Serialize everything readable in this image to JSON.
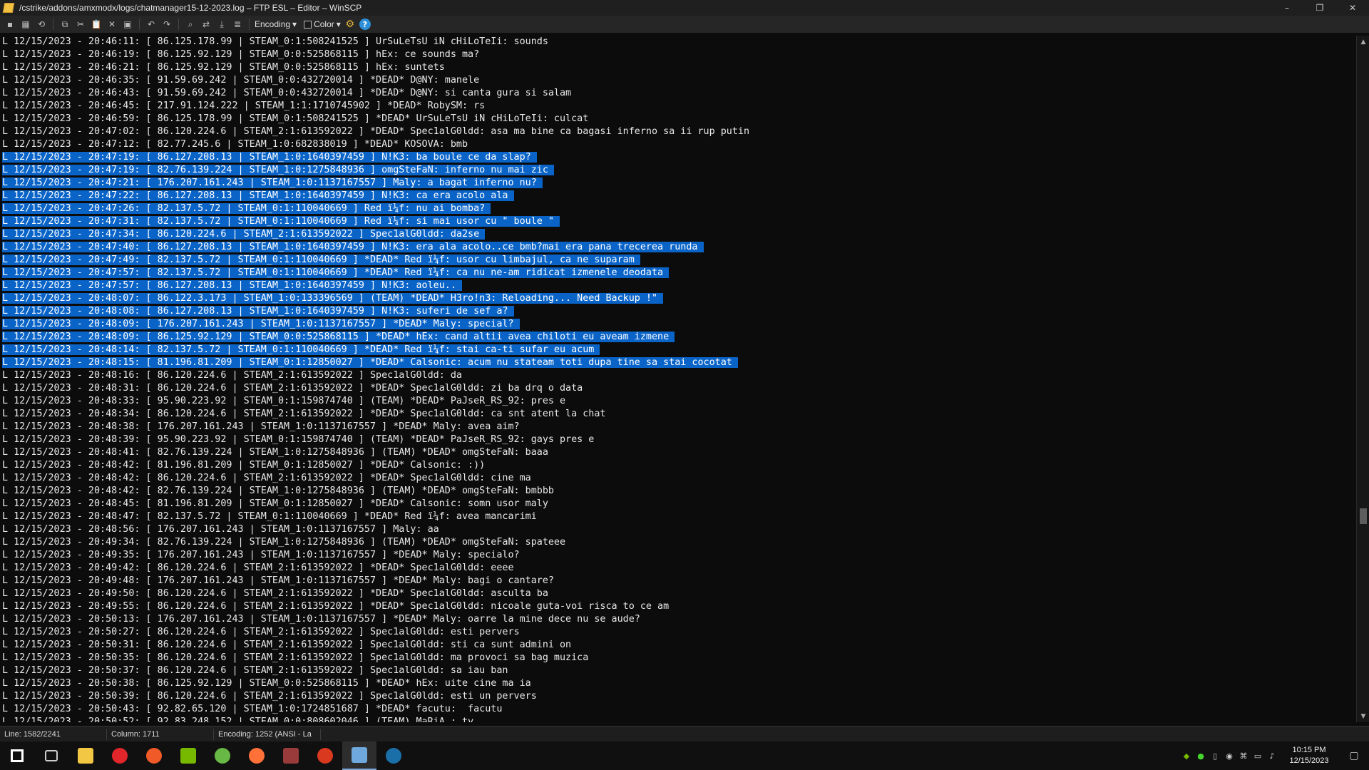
{
  "window": {
    "title": "/cstrike/addons/amxmodx/logs/chatmanager15-12-2023.log – FTP ESL – Editor – WinSCP",
    "minimize": "–",
    "restore": "❐",
    "close": "✕"
  },
  "toolbar": {
    "encoding_label": "Encoding",
    "color_label": "Color",
    "help_label": "?"
  },
  "editor": {
    "lines": [
      {
        "text": "L 12/15/2023 - 20:46:11: [ 86.125.178.99 | STEAM_0:1:508241525 ] UrSuLeTsU iN cHiLoTeIi: sounds",
        "selected": false
      },
      {
        "text": "L 12/15/2023 - 20:46:19: [ 86.125.92.129 | STEAM_0:0:525868115 ] hEx: ce sounds ma?",
        "selected": false
      },
      {
        "text": "L 12/15/2023 - 20:46:21: [ 86.125.92.129 | STEAM_0:0:525868115 ] hEx: suntets",
        "selected": false
      },
      {
        "text": "L 12/15/2023 - 20:46:35: [ 91.59.69.242 | STEAM_0:0:432720014 ] *DEAD* D@NY: manele",
        "selected": false
      },
      {
        "text": "L 12/15/2023 - 20:46:43: [ 91.59.69.242 | STEAM_0:0:432720014 ] *DEAD* D@NY: si canta gura si salam",
        "selected": false
      },
      {
        "text": "L 12/15/2023 - 20:46:45: [ 217.91.124.222 | STEAM_1:1:1710745902 ] *DEAD* RobySM: rs",
        "selected": false
      },
      {
        "text": "L 12/15/2023 - 20:46:59: [ 86.125.178.99 | STEAM_0:1:508241525 ] *DEAD* UrSuLeTsU iN cHiLoTeIi: culcat",
        "selected": false
      },
      {
        "text": "L 12/15/2023 - 20:47:02: [ 86.120.224.6 | STEAM_2:1:613592022 ] *DEAD* Spec1alG0ldd: asa ma bine ca bagasi inferno sa ii rup putin",
        "selected": false
      },
      {
        "text": "L 12/15/2023 - 20:47:12: [ 82.77.245.6 | STEAM_1:0:682838019 ] *DEAD* KOSOVA: bmb",
        "selected": false
      },
      {
        "text": "L 12/15/2023 - 20:47:19: [ 86.127.208.13 | STEAM_1:0:1640397459 ] N!K3: ba boule ce da slap? ",
        "selected": true
      },
      {
        "text": "L 12/15/2023 - 20:47:19: [ 82.76.139.224 | STEAM_1:0:1275848936 ] omgSteFaN: inferno nu mai zic ",
        "selected": true
      },
      {
        "text": "L 12/15/2023 - 20:47:21: [ 176.207.161.243 | STEAM_1:0:1137167557 ] Maly: a bagat inferno nu? ",
        "selected": true
      },
      {
        "text": "L 12/15/2023 - 20:47:22: [ 86.127.208.13 | STEAM_1:0:1640397459 ] N!K3: ca era acolo ala ",
        "selected": true
      },
      {
        "text": "L 12/15/2023 - 20:47:26: [ 82.137.5.72 | STEAM_0:1:110040669 ] Red ï¼f: nu ai bomba? ",
        "selected": true
      },
      {
        "text": "L 12/15/2023 - 20:47:31: [ 82.137.5.72 | STEAM_0:1:110040669 ] Red ï¼f: si mai usor cu \" boule \" ",
        "selected": true
      },
      {
        "text": "L 12/15/2023 - 20:47:34: [ 86.120.224.6 | STEAM_2:1:613592022 ] Spec1alG0ldd: da2se ",
        "selected": true
      },
      {
        "text": "L 12/15/2023 - 20:47:40: [ 86.127.208.13 | STEAM_1:0:1640397459 ] N!K3: era ala acolo..ce bmb?mai era pana trecerea runda ",
        "selected": true
      },
      {
        "text": "L 12/15/2023 - 20:47:49: [ 82.137.5.72 | STEAM_0:1:110040669 ] *DEAD* Red ï¼f: usor cu limbajul, ca ne suparam ",
        "selected": true
      },
      {
        "text": "L 12/15/2023 - 20:47:57: [ 82.137.5.72 | STEAM_0:1:110040669 ] *DEAD* Red ï¼f: ca nu ne-am ridicat izmenele deodata ",
        "selected": true
      },
      {
        "text": "L 12/15/2023 - 20:47:57: [ 86.127.208.13 | STEAM_1:0:1640397459 ] N!K3: aoleu.. ",
        "selected": true
      },
      {
        "text": "L 12/15/2023 - 20:48:07: [ 86.122.3.173 | STEAM_1:0:133396569 ] (TEAM) *DEAD* H3ro!n3: Reloading... Need Backup !\" ",
        "selected": true
      },
      {
        "text": "L 12/15/2023 - 20:48:08: [ 86.127.208.13 | STEAM_1:0:1640397459 ] N!K3: suferi de sef a? ",
        "selected": true
      },
      {
        "text": "L 12/15/2023 - 20:48:09: [ 176.207.161.243 | STEAM_1:0:1137167557 ] *DEAD* Maly: special? ",
        "selected": true
      },
      {
        "text": "L 12/15/2023 - 20:48:09: [ 86.125.92.129 | STEAM_0:0:525868115 ] *DEAD* hEx: cand altii avea chiloti eu aveam izmene ",
        "selected": true
      },
      {
        "text": "L 12/15/2023 - 20:48:14: [ 82.137.5.72 | STEAM_0:1:110040669 ] *DEAD* Red ï¼f: stai ca-ti sufar eu acum ",
        "selected": true
      },
      {
        "text": "L 12/15/2023 - 20:48:15: [ 81.196.81.209 | STEAM_0:1:12850027 ] *DEAD* Calsonic: acum nu stateam toti dupa tine sa stai cocotat ",
        "selected": true
      },
      {
        "text": "L 12/15/2023 - 20:48:16: [ 86.120.224.6 | STEAM_2:1:613592022 ] Spec1alG0ldd: da",
        "selected": false
      },
      {
        "text": "L 12/15/2023 - 20:48:31: [ 86.120.224.6 | STEAM_2:1:613592022 ] *DEAD* Spec1alG0ldd: zi ba drq o data",
        "selected": false
      },
      {
        "text": "L 12/15/2023 - 20:48:33: [ 95.90.223.92 | STEAM_0:1:159874740 ] (TEAM) *DEAD* PaJseR_RS_92: pres e",
        "selected": false
      },
      {
        "text": "L 12/15/2023 - 20:48:34: [ 86.120.224.6 | STEAM_2:1:613592022 ] *DEAD* Spec1alG0ldd: ca snt atent la chat",
        "selected": false
      },
      {
        "text": "L 12/15/2023 - 20:48:38: [ 176.207.161.243 | STEAM_1:0:1137167557 ] *DEAD* Maly: avea aim?",
        "selected": false
      },
      {
        "text": "L 12/15/2023 - 20:48:39: [ 95.90.223.92 | STEAM_0:1:159874740 ] (TEAM) *DEAD* PaJseR_RS_92: gays pres e",
        "selected": false
      },
      {
        "text": "L 12/15/2023 - 20:48:41: [ 82.76.139.224 | STEAM_1:0:1275848936 ] (TEAM) *DEAD* omgSteFaN: baaa",
        "selected": false
      },
      {
        "text": "L 12/15/2023 - 20:48:42: [ 81.196.81.209 | STEAM_0:1:12850027 ] *DEAD* Calsonic: :))",
        "selected": false
      },
      {
        "text": "L 12/15/2023 - 20:48:42: [ 86.120.224.6 | STEAM_2:1:613592022 ] *DEAD* Spec1alG0ldd: cine ma",
        "selected": false
      },
      {
        "text": "L 12/15/2023 - 20:48:42: [ 82.76.139.224 | STEAM_1:0:1275848936 ] (TEAM) *DEAD* omgSteFaN: bmbbb",
        "selected": false
      },
      {
        "text": "L 12/15/2023 - 20:48:45: [ 81.196.81.209 | STEAM_0:1:12850027 ] *DEAD* Calsonic: somn usor maly",
        "selected": false
      },
      {
        "text": "L 12/15/2023 - 20:48:47: [ 82.137.5.72 | STEAM_0:1:110040669 ] *DEAD* Red ï¼f: avea mancarimi",
        "selected": false
      },
      {
        "text": "L 12/15/2023 - 20:48:56: [ 176.207.161.243 | STEAM_1:0:1137167557 ] Maly: aa",
        "selected": false
      },
      {
        "text": "L 12/15/2023 - 20:49:34: [ 82.76.139.224 | STEAM_1:0:1275848936 ] (TEAM) *DEAD* omgSteFaN: spateee",
        "selected": false
      },
      {
        "text": "L 12/15/2023 - 20:49:35: [ 176.207.161.243 | STEAM_1:0:1137167557 ] *DEAD* Maly: specialo?",
        "selected": false
      },
      {
        "text": "L 12/15/2023 - 20:49:42: [ 86.120.224.6 | STEAM_2:1:613592022 ] *DEAD* Spec1alG0ldd: eeee",
        "selected": false
      },
      {
        "text": "L 12/15/2023 - 20:49:48: [ 176.207.161.243 | STEAM_1:0:1137167557 ] *DEAD* Maly: bagi o cantare?",
        "selected": false
      },
      {
        "text": "L 12/15/2023 - 20:49:50: [ 86.120.224.6 | STEAM_2:1:613592022 ] *DEAD* Spec1alG0ldd: asculta ba",
        "selected": false
      },
      {
        "text": "L 12/15/2023 - 20:49:55: [ 86.120.224.6 | STEAM_2:1:613592022 ] *DEAD* Spec1alG0ldd: nicoale guta-voi risca to ce am",
        "selected": false
      },
      {
        "text": "L 12/15/2023 - 20:50:13: [ 176.207.161.243 | STEAM_1:0:1137167557 ] *DEAD* Maly: oarre la mine dece nu se aude?",
        "selected": false
      },
      {
        "text": "L 12/15/2023 - 20:50:27: [ 86.120.224.6 | STEAM_2:1:613592022 ] Spec1alG0ldd: esti pervers",
        "selected": false
      },
      {
        "text": "L 12/15/2023 - 20:50:31: [ 86.120.224.6 | STEAM_2:1:613592022 ] Spec1alG0ldd: sti ca sunt admini on",
        "selected": false
      },
      {
        "text": "L 12/15/2023 - 20:50:35: [ 86.120.224.6 | STEAM_2:1:613592022 ] Spec1alG0ldd: ma provoci sa bag muzica",
        "selected": false
      },
      {
        "text": "L 12/15/2023 - 20:50:37: [ 86.120.224.6 | STEAM_2:1:613592022 ] Spec1alG0ldd: sa iau ban",
        "selected": false
      },
      {
        "text": "L 12/15/2023 - 20:50:38: [ 86.125.92.129 | STEAM_0:0:525868115 ] *DEAD* hEx: uite cine ma ia",
        "selected": false
      },
      {
        "text": "L 12/15/2023 - 20:50:39: [ 86.120.224.6 | STEAM_2:1:613592022 ] Spec1alG0ldd: esti un pervers",
        "selected": false
      },
      {
        "text": "L 12/15/2023 - 20:50:43: [ 92.82.65.120 | STEAM_1:0:1724851687 ] *DEAD* facutu:  facutu",
        "selected": false
      },
      {
        "text": "L 12/15/2023 - 20:50:52: [ 92.83.248.152 | STEAM_0:0:808602046 ] (TEAM) MaRiA : ty",
        "selected": false
      }
    ]
  },
  "statusbar": {
    "line": "Line: 1582/2241",
    "column": "Column: 1711",
    "encoding": "Encoding: 1252  (ANSI - La"
  },
  "taskbar": {
    "clock_time": "10:15 PM",
    "clock_date": "12/15/2023",
    "apps": [
      {
        "name": "windows-start-icon",
        "color": "#ffffff"
      },
      {
        "name": "task-view-icon",
        "color": "#cccccc"
      },
      {
        "name": "file-explorer-icon",
        "color": "#f2c744"
      },
      {
        "name": "opera-icon",
        "color": "#e0262b"
      },
      {
        "name": "ea-app-icon",
        "color": "#f05a28"
      },
      {
        "name": "nvidia-icon",
        "color": "#76b900"
      },
      {
        "name": "utorrent-icon",
        "color": "#68b845"
      },
      {
        "name": "firefox-icon",
        "color": "#ff7139"
      },
      {
        "name": "game-app-icon",
        "color": "#9a3b3b"
      },
      {
        "name": "game-launcher-icon",
        "color": "#d93a1f"
      },
      {
        "name": "winscp-icon",
        "color": "#6fa8dc"
      },
      {
        "name": "steam-icon",
        "color": "#1b6fa8"
      }
    ]
  }
}
